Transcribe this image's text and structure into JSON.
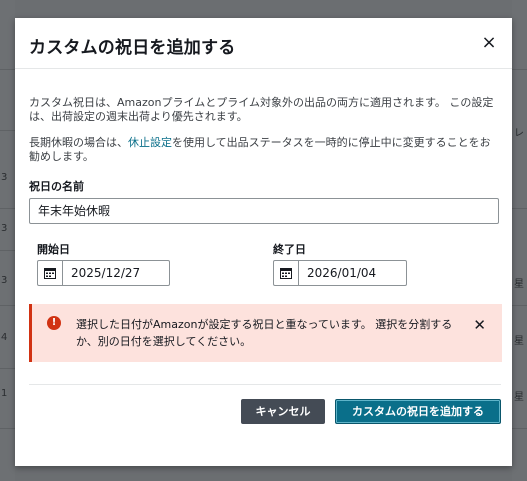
{
  "background_fragments": [
    "3",
    "3",
    "3",
    "4",
    "1",
    "レ",
    "星",
    "星",
    "星"
  ],
  "modal": {
    "title": "カスタムの祝日を追加する",
    "close_icon": "×",
    "description1": "カスタム祝日は、Amazonプライムとプライム対象外の出品の両方に適用されます。 この設定は、出荷設定の週末出荷より優先されます。",
    "description2_prefix": "長期休暇の場合は、",
    "description2_link": "休止設定",
    "description2_suffix": "を使用して出品ステータスを一時的に停止中に変更することをお勧めします。",
    "holiday_name_label": "祝日の名前",
    "holiday_name_value": "年末年始休暇",
    "start_label": "開始日",
    "start_value": "2025/12/27",
    "end_label": "終了日",
    "end_value": "2026/01/04",
    "alert": {
      "icon": "!",
      "text": "選択した日付がAmazonが設定する祝日と重なっています。 選択を分割するか、別の日付を選択してください。",
      "close": "✕",
      "color": "#d13212"
    },
    "cancel_label": "キャンセル",
    "submit_label": "カスタムの祝日を追加する",
    "accent_color": "#0a6f8a"
  }
}
